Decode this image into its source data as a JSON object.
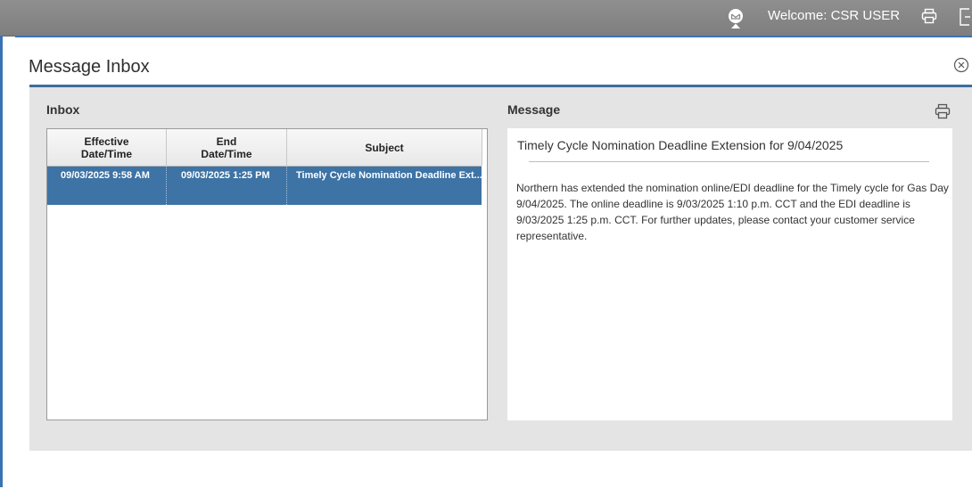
{
  "topbar": {
    "welcome_text": "Welcome: CSR USER",
    "icons": [
      "mail-notification-icon",
      "printer-icon",
      "logout-icon"
    ]
  },
  "modal": {
    "title": "Message Inbox",
    "close_icon": "close-circle-icon"
  },
  "inbox": {
    "label": "Inbox",
    "columns": [
      {
        "line1": "Effective",
        "line2": "Date/Time"
      },
      {
        "line1": "End",
        "line2": "Date/Time"
      },
      {
        "line1": "Subject",
        "line2": ""
      }
    ],
    "rows": [
      {
        "effective": "09/03/2025 9:58 AM",
        "end": "09/03/2025 1:25 PM",
        "subject": "Timely Cycle Nomination Deadline Ext...",
        "selected": true
      }
    ]
  },
  "message": {
    "label": "Message",
    "subject": "Timely Cycle Nomination Deadline Extension for 9/04/2025",
    "body": "Northern has extended the nomination online/EDI deadline for the Timely cycle for Gas Day 9/04/2025. The online deadline is 9/03/2025 1:10 p.m. CCT and the EDI deadline is 9/03/2025 1:25 p.m. CCT. For further updates, please contact your customer service representative."
  },
  "colors": {
    "accent": "#3a73b3",
    "selected_row": "#3d73a5",
    "topbar": "#8a8a8a",
    "panel": "#e4e4e4"
  }
}
